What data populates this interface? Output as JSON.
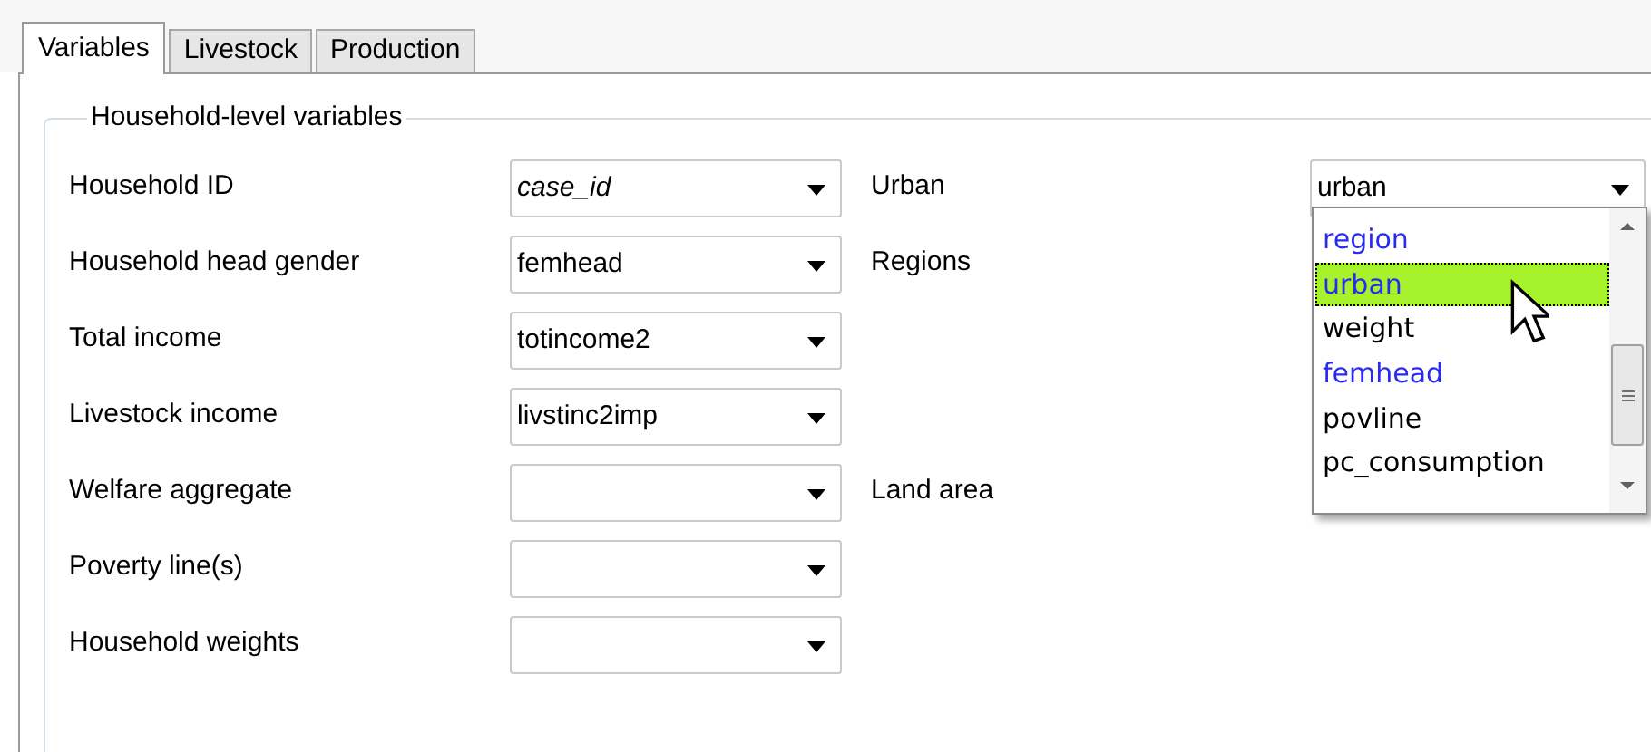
{
  "tabs": [
    {
      "label": "Variables",
      "selected": true
    },
    {
      "label": "Livestock",
      "selected": false
    },
    {
      "label": "Production",
      "selected": false
    }
  ],
  "group": {
    "title": "Household-level variables"
  },
  "rows": [
    {
      "label": "Household ID",
      "field": {
        "value": "case_id",
        "italic": true
      },
      "right": {
        "label": "Urban",
        "value": "urban"
      }
    },
    {
      "label": "Household head gender",
      "field": {
        "value": "femhead",
        "italic": false
      },
      "right": {
        "label": "Regions"
      }
    },
    {
      "label": "Total income",
      "field": {
        "value": "totincome2",
        "italic": false
      }
    },
    {
      "label": "Livestock income",
      "field": {
        "value": "livstinc2imp",
        "italic": false
      }
    },
    {
      "label": "Welfare aggregate",
      "right": {
        "label": "Land area"
      }
    },
    {
      "label": "Poverty line(s)"
    },
    {
      "label": "Household weights"
    }
  ],
  "dropdown": {
    "items": [
      {
        "label": "region",
        "color": "#2a2af0",
        "selected": false
      },
      {
        "label": "urban",
        "color": "#2a2af0",
        "selected": true
      },
      {
        "label": "weight",
        "color": "#000000",
        "selected": false
      },
      {
        "label": "femhead",
        "color": "#2a2af0",
        "selected": false
      },
      {
        "label": "povline",
        "color": "#000000",
        "selected": false
      },
      {
        "label": "pc_consumption",
        "color": "#000000",
        "selected": false
      }
    ]
  }
}
